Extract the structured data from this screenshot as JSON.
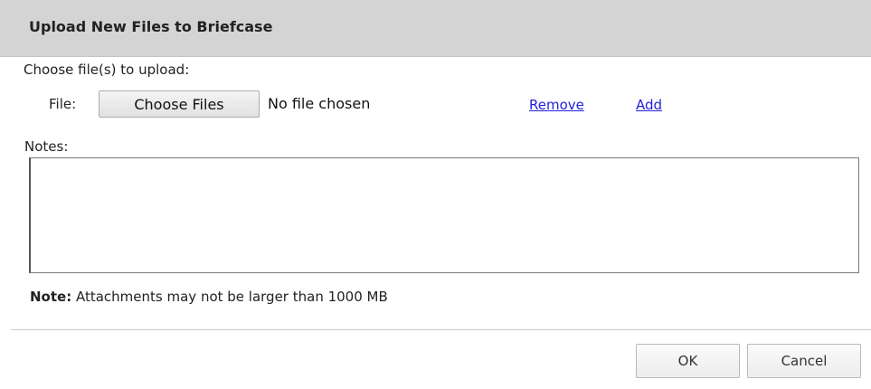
{
  "dialog": {
    "title": "Upload New Files to Briefcase",
    "choose_label": "Choose file(s) to upload:",
    "file_label": "File:",
    "choose_files_button": "Choose Files",
    "no_file_text": "No file chosen",
    "remove_link": "Remove",
    "add_link": "Add",
    "notes_label": "Notes:",
    "notes_value": "",
    "note_prefix": "Note:",
    "note_text": " Attachments may not be larger than 1000 MB",
    "ok_button": "OK",
    "cancel_button": "Cancel"
  },
  "colors": {
    "titlebar": "#d4d4d4",
    "link": "#2222dd"
  }
}
